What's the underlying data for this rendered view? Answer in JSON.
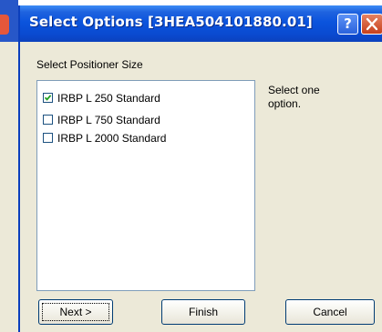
{
  "dialog": {
    "title": "Select Options [3HEA504101880.01]",
    "help_button": "?",
    "close_button": "X"
  },
  "section": {
    "label": "Select Positioner Size"
  },
  "options": [
    {
      "label": "IRBP L 250 Standard",
      "checked": true
    },
    {
      "label": "IRBP L 750 Standard",
      "checked": false
    },
    {
      "label": "IRBP L 2000 Standard",
      "checked": false
    }
  ],
  "hint": "Select one option.",
  "buttons": {
    "next": "Next >",
    "finish": "Finish",
    "cancel": "Cancel"
  },
  "colors": {
    "titlebar": "#0a4ad0",
    "dialog_bg": "#ece9d8",
    "close_button": "#c7401c"
  }
}
